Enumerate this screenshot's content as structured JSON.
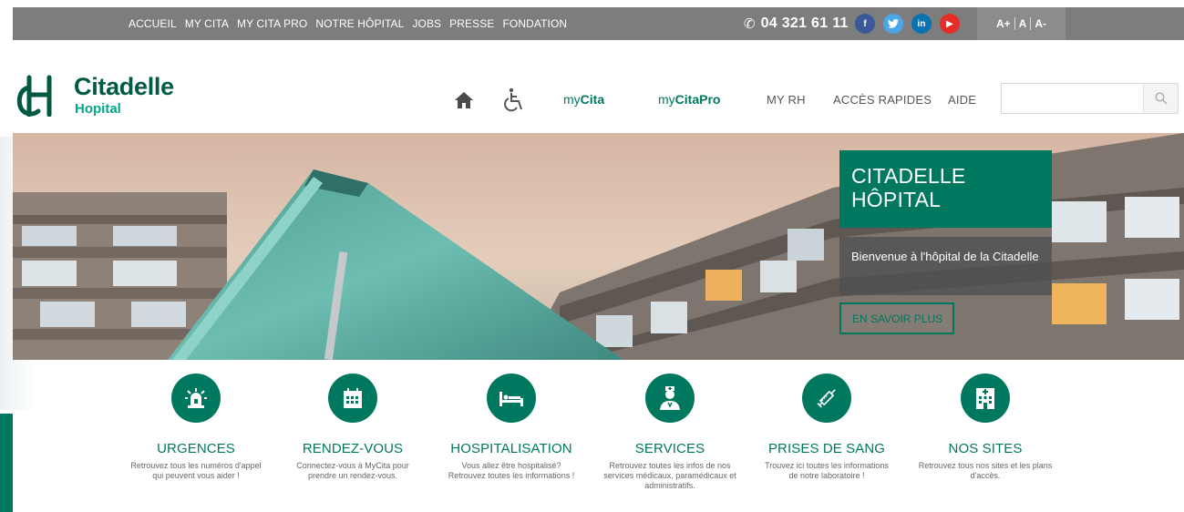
{
  "topbar": {
    "links": [
      "ACCUEIL",
      "MY CITA",
      "MY CITA PRO",
      "NOTRE HÔPITAL",
      "JOBS",
      "PRESSE",
      "FONDATION"
    ],
    "phone": "04 321 61 11",
    "socials": [
      {
        "name": "facebook",
        "glyph": "f"
      },
      {
        "name": "twitter",
        "glyph": "t"
      },
      {
        "name": "linkedin",
        "glyph": "in"
      },
      {
        "name": "youtube",
        "glyph": "▶"
      }
    ],
    "font_sizes": [
      "A+",
      "A",
      "A-"
    ]
  },
  "logo": {
    "name": "Citadelle",
    "sub": "Hopital"
  },
  "nav": {
    "mycita": {
      "prefix": "my",
      "bold": "Cita"
    },
    "mycitapro": {
      "prefix": "my",
      "bold": "CitaPro"
    },
    "links": [
      "MY RH",
      "ACCÈS RAPIDES",
      "AIDE"
    ]
  },
  "search": {
    "placeholder": "",
    "value": ""
  },
  "hero": {
    "title_line1": "CITADELLE",
    "title_line2": "HÔPITAL",
    "text": "Bienvenue à l'hôpital de la Citadelle",
    "button": "EN SAVOIR PLUS"
  },
  "features": [
    {
      "icon": "siren-icon",
      "title": "URGENCES",
      "desc": "Retrouvez tous les numéros d'appel qui peuvent vous aider !"
    },
    {
      "icon": "calendar-icon",
      "title": "RENDEZ-VOUS",
      "desc": "Connectez-vous à MyCita pour prendre un rendez-vous."
    },
    {
      "icon": "bed-icon",
      "title": "HOSPITALISATION",
      "desc": "Vous allez être hospitalisé? Retrouvez toutes les informations !"
    },
    {
      "icon": "doctor-icon",
      "title": "SERVICES",
      "desc": "Retrouvez toutes les infos de nos services médicaux, paramédicaux et administratifs."
    },
    {
      "icon": "syringe-icon",
      "title": "PRISES DE SANG",
      "desc": "Trouvez ici toutes les informations de notre laboratoire !"
    },
    {
      "icon": "hospital-building-icon",
      "title": "NOS SITES",
      "desc": "Retrouvez tous nos sites et les plans d'accès."
    }
  ],
  "colors": {
    "brand": "#00785f",
    "brand_light": "#00a88a",
    "topbar": "#7d7d7d"
  }
}
